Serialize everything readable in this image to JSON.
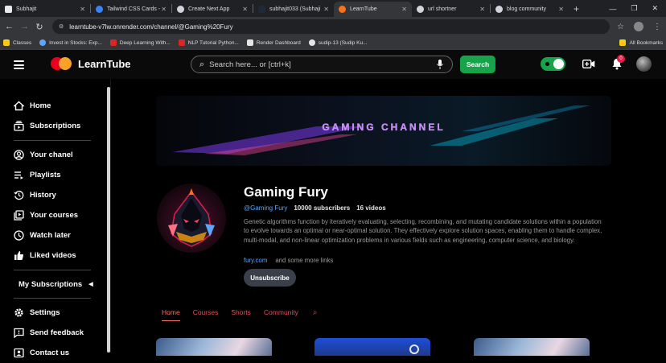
{
  "browser": {
    "tabs": [
      {
        "label": "Subhajit",
        "fav_color": "#e8eaed",
        "active": false
      },
      {
        "label": "Tailwind CSS Cards -",
        "fav_color": "#3b82f6",
        "active": false
      },
      {
        "label": "Create Next App",
        "fav_color": "#d1d5db",
        "active": false
      },
      {
        "label": "subhajit033 (Subhaji",
        "fav_color": "#1f2937",
        "active": false
      },
      {
        "label": "LearnTube",
        "fav_color": "#f97316",
        "active": true
      },
      {
        "label": "url shortner",
        "fav_color": "#d1d5db",
        "active": false
      },
      {
        "label": "blog community",
        "fav_color": "#d1d5db",
        "active": false
      }
    ],
    "url": "learntube-v7lw.onrender.com/channel/@Gaming%20Fury",
    "bookmarks": [
      {
        "label": "Classes",
        "color": "#facc15"
      },
      {
        "label": "Invest in Stocks: Exp...",
        "color": "#60a5fa"
      },
      {
        "label": "Deep Learning With...",
        "color": "#dc2626"
      },
      {
        "label": "NLP Tutorial Python...",
        "color": "#dc2626"
      },
      {
        "label": "Render Dashboard",
        "color": "#e5e5e5"
      },
      {
        "label": "sudip-13 (Sudip Ku...",
        "color": "#e5e5e5"
      }
    ],
    "all_bookmarks": "All Bookmarks"
  },
  "header": {
    "logo_text": "LearnTube",
    "search_placeholder": "Search here... or [ctrl+k]",
    "search_button": "Search",
    "notification_count": "0",
    "accent": "#16a34a"
  },
  "sidebar": {
    "items": [
      {
        "label": "Home",
        "icon": "home-icon"
      },
      {
        "label": "Subscriptions",
        "icon": "subscriptions-icon"
      },
      {
        "label": "Your chanel",
        "icon": "account-icon"
      },
      {
        "label": "Playlists",
        "icon": "playlist-icon"
      },
      {
        "label": "History",
        "icon": "history-icon"
      },
      {
        "label": "Your courses",
        "icon": "courses-icon"
      },
      {
        "label": "Watch later",
        "icon": "clock-icon"
      },
      {
        "label": "Liked videos",
        "icon": "thumbs-up-icon"
      }
    ],
    "my_subscriptions": "My Subscriptions",
    "bottom_items": [
      {
        "label": "Settings",
        "icon": "gear-icon"
      },
      {
        "label": "Send feedback",
        "icon": "feedback-icon"
      },
      {
        "label": "Contact us",
        "icon": "contact-icon"
      }
    ]
  },
  "channel": {
    "banner_title": "GAMING CHANNEL",
    "name": "Gaming Fury",
    "handle": "@Gaming Fury",
    "subscribers": "10000 subscribers",
    "videos": "16 videos",
    "description": "Genetic algorithms function by iteratively evaluating, selecting, recombining, and mutating candidate solutions within a population to evolve towards an optimal or near-optimal solution. They effectively explore solution spaces, enabling them to handle complex, multi-modal, and non-linear optimization problems in various fields such as engineering, computer science, and biology.",
    "link": "fury.com",
    "more_links": "and some more links",
    "unsubscribe": "Unsubscribe",
    "tabs": [
      "Home",
      "Courses",
      "Shorts",
      "Community"
    ],
    "active_tab": "Home"
  }
}
